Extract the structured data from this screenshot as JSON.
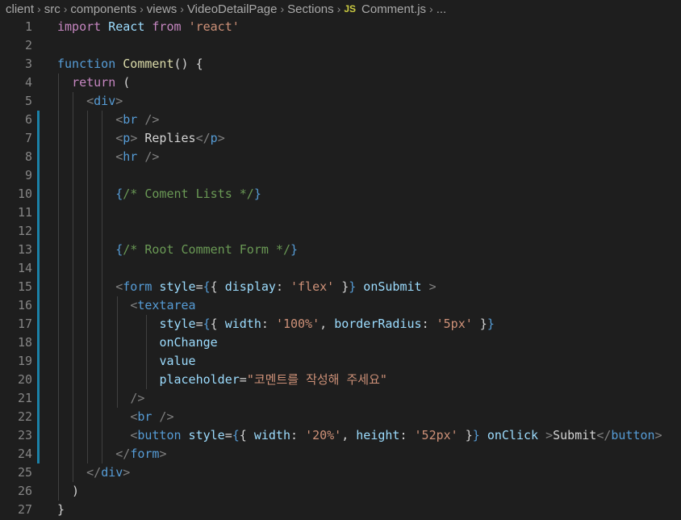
{
  "breadcrumb": {
    "items": [
      "client",
      "src",
      "components",
      "views",
      "VideoDetailPage",
      "Sections"
    ],
    "file_icon": "JS",
    "file": "Comment.js",
    "ellipsis": "..."
  },
  "editor": {
    "line_numbers": [
      "1",
      "2",
      "3",
      "4",
      "5",
      "6",
      "7",
      "8",
      "9",
      "10",
      "11",
      "12",
      "13",
      "14",
      "15",
      "16",
      "17",
      "18",
      "19",
      "20",
      "21",
      "22",
      "23",
      "24",
      "25",
      "26",
      "27"
    ],
    "lines": [
      [
        {
          "t": "import",
          "c": "kw2"
        },
        {
          "t": " React ",
          "c": "var"
        },
        {
          "t": "from",
          "c": "kw2"
        },
        {
          "t": " ",
          "c": "txt"
        },
        {
          "t": "'react'",
          "c": "str"
        }
      ],
      [],
      [
        {
          "t": "function",
          "c": "kw"
        },
        {
          "t": " ",
          "c": "txt"
        },
        {
          "t": "Comment",
          "c": "fn"
        },
        {
          "t": "() {",
          "c": "txt"
        }
      ],
      [
        {
          "t": "  ",
          "c": "txt"
        },
        {
          "t": "return",
          "c": "kw2"
        },
        {
          "t": " (",
          "c": "txt"
        }
      ],
      [
        {
          "t": "    ",
          "c": "txt"
        },
        {
          "t": "<",
          "c": "punct"
        },
        {
          "t": "div",
          "c": "tag"
        },
        {
          "t": ">",
          "c": "punct"
        }
      ],
      [
        {
          "t": "        ",
          "c": "txt"
        },
        {
          "t": "<",
          "c": "punct"
        },
        {
          "t": "br",
          "c": "tag"
        },
        {
          "t": " />",
          "c": "punct"
        }
      ],
      [
        {
          "t": "        ",
          "c": "txt"
        },
        {
          "t": "<",
          "c": "punct"
        },
        {
          "t": "p",
          "c": "tag"
        },
        {
          "t": ">",
          "c": "punct"
        },
        {
          "t": " Replies",
          "c": "txt"
        },
        {
          "t": "</",
          "c": "punct"
        },
        {
          "t": "p",
          "c": "tag"
        },
        {
          "t": ">",
          "c": "punct"
        }
      ],
      [
        {
          "t": "        ",
          "c": "txt"
        },
        {
          "t": "<",
          "c": "punct"
        },
        {
          "t": "hr",
          "c": "tag"
        },
        {
          "t": " />",
          "c": "punct"
        }
      ],
      [],
      [
        {
          "t": "        ",
          "c": "txt"
        },
        {
          "t": "{",
          "c": "brace"
        },
        {
          "t": "/* Coment Lists */",
          "c": "cmt"
        },
        {
          "t": "}",
          "c": "brace"
        }
      ],
      [],
      [],
      [
        {
          "t": "        ",
          "c": "txt"
        },
        {
          "t": "{",
          "c": "brace"
        },
        {
          "t": "/* Root Comment Form */",
          "c": "cmt"
        },
        {
          "t": "}",
          "c": "brace"
        }
      ],
      [],
      [
        {
          "t": "        ",
          "c": "txt"
        },
        {
          "t": "<",
          "c": "punct"
        },
        {
          "t": "form",
          "c": "tag"
        },
        {
          "t": " style",
          "c": "var"
        },
        {
          "t": "=",
          "c": "txt"
        },
        {
          "t": "{",
          "c": "brace"
        },
        {
          "t": "{ ",
          "c": "txt"
        },
        {
          "t": "display",
          "c": "var"
        },
        {
          "t": ": ",
          "c": "txt"
        },
        {
          "t": "'flex'",
          "c": "str"
        },
        {
          "t": " }",
          "c": "txt"
        },
        {
          "t": "}",
          "c": "brace"
        },
        {
          "t": " onSubmit",
          "c": "var"
        },
        {
          "t": " >",
          "c": "punct"
        }
      ],
      [
        {
          "t": "          ",
          "c": "txt"
        },
        {
          "t": "<",
          "c": "punct"
        },
        {
          "t": "textarea",
          "c": "tag"
        }
      ],
      [
        {
          "t": "              ",
          "c": "txt"
        },
        {
          "t": "style",
          "c": "var"
        },
        {
          "t": "=",
          "c": "txt"
        },
        {
          "t": "{",
          "c": "brace"
        },
        {
          "t": "{ ",
          "c": "txt"
        },
        {
          "t": "width",
          "c": "var"
        },
        {
          "t": ": ",
          "c": "txt"
        },
        {
          "t": "'100%'",
          "c": "str"
        },
        {
          "t": ", ",
          "c": "txt"
        },
        {
          "t": "borderRadius",
          "c": "var"
        },
        {
          "t": ": ",
          "c": "txt"
        },
        {
          "t": "'5px'",
          "c": "str"
        },
        {
          "t": " }",
          "c": "txt"
        },
        {
          "t": "}",
          "c": "brace"
        }
      ],
      [
        {
          "t": "              ",
          "c": "txt"
        },
        {
          "t": "onChange",
          "c": "var"
        }
      ],
      [
        {
          "t": "              ",
          "c": "txt"
        },
        {
          "t": "value",
          "c": "var"
        }
      ],
      [
        {
          "t": "              ",
          "c": "txt"
        },
        {
          "t": "placeholder",
          "c": "var"
        },
        {
          "t": "=",
          "c": "txt"
        },
        {
          "t": "\"코멘트를 작성해 주세요\"",
          "c": "str"
        }
      ],
      [
        {
          "t": "          ",
          "c": "txt"
        },
        {
          "t": "/>",
          "c": "punct"
        }
      ],
      [
        {
          "t": "          ",
          "c": "txt"
        },
        {
          "t": "<",
          "c": "punct"
        },
        {
          "t": "br",
          "c": "tag"
        },
        {
          "t": " />",
          "c": "punct"
        }
      ],
      [
        {
          "t": "          ",
          "c": "txt"
        },
        {
          "t": "<",
          "c": "punct"
        },
        {
          "t": "button",
          "c": "tag"
        },
        {
          "t": " style",
          "c": "var"
        },
        {
          "t": "=",
          "c": "txt"
        },
        {
          "t": "{",
          "c": "brace"
        },
        {
          "t": "{ ",
          "c": "txt"
        },
        {
          "t": "width",
          "c": "var"
        },
        {
          "t": ": ",
          "c": "txt"
        },
        {
          "t": "'20%'",
          "c": "str"
        },
        {
          "t": ", ",
          "c": "txt"
        },
        {
          "t": "height",
          "c": "var"
        },
        {
          "t": ": ",
          "c": "txt"
        },
        {
          "t": "'52px'",
          "c": "str"
        },
        {
          "t": " }",
          "c": "txt"
        },
        {
          "t": "}",
          "c": "brace"
        },
        {
          "t": " onClick",
          "c": "var"
        },
        {
          "t": " >",
          "c": "punct"
        },
        {
          "t": "Submit",
          "c": "txt"
        },
        {
          "t": "</",
          "c": "punct"
        },
        {
          "t": "button",
          "c": "tag"
        },
        {
          "t": ">",
          "c": "punct"
        }
      ],
      [
        {
          "t": "        ",
          "c": "txt"
        },
        {
          "t": "</",
          "c": "punct"
        },
        {
          "t": "form",
          "c": "tag"
        },
        {
          "t": ">",
          "c": "punct"
        }
      ],
      [
        {
          "t": "    ",
          "c": "txt"
        },
        {
          "t": "</",
          "c": "punct"
        },
        {
          "t": "div",
          "c": "tag"
        },
        {
          "t": ">",
          "c": "punct"
        }
      ],
      [
        {
          "t": "  )",
          "c": "txt"
        }
      ],
      [
        {
          "t": "}",
          "c": "txt"
        }
      ]
    ]
  }
}
